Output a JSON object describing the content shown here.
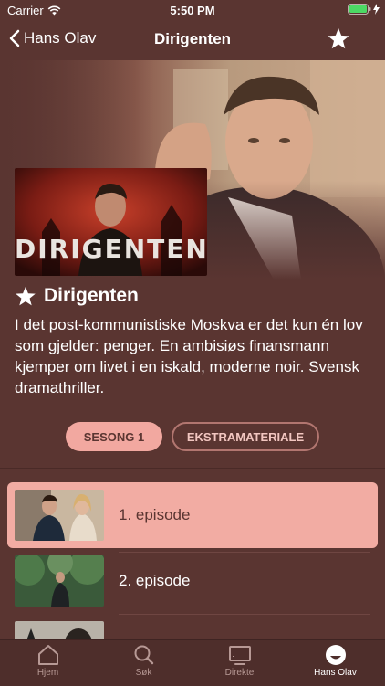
{
  "status": {
    "carrier": "Carrier",
    "time": "5:50 PM"
  },
  "nav": {
    "back_label": "Hans Olav",
    "title": "Dirigenten"
  },
  "hero": {
    "poster_title": "DIRIGENTEN"
  },
  "show": {
    "title": "Dirigenten",
    "description": "I det post-kommunistiske Moskva er det kun én lov som gjelder: penger. En ambisiøs finansmann kjemper om livet i en iskald, moderne noir. Svensk dramathriller."
  },
  "tabs": [
    {
      "label": "SESONG 1",
      "active": true
    },
    {
      "label": "EKSTRAMATERIALE",
      "active": false
    }
  ],
  "episodes": [
    {
      "label": "1. episode",
      "selected": true
    },
    {
      "label": "2. episode",
      "selected": false
    },
    {
      "label": "",
      "selected": false
    }
  ],
  "tabbar": [
    {
      "label": "Hjem",
      "icon": "home-icon",
      "active": false
    },
    {
      "label": "Søk",
      "icon": "search-icon",
      "active": false
    },
    {
      "label": "Direkte",
      "icon": "tv-icon",
      "active": false
    },
    {
      "label": "Hans Olav",
      "icon": "profile-icon",
      "active": true
    }
  ],
  "colors": {
    "background": "#5a3531",
    "accent": "#f2a8a0",
    "tabbar": "#4e2e2b"
  }
}
